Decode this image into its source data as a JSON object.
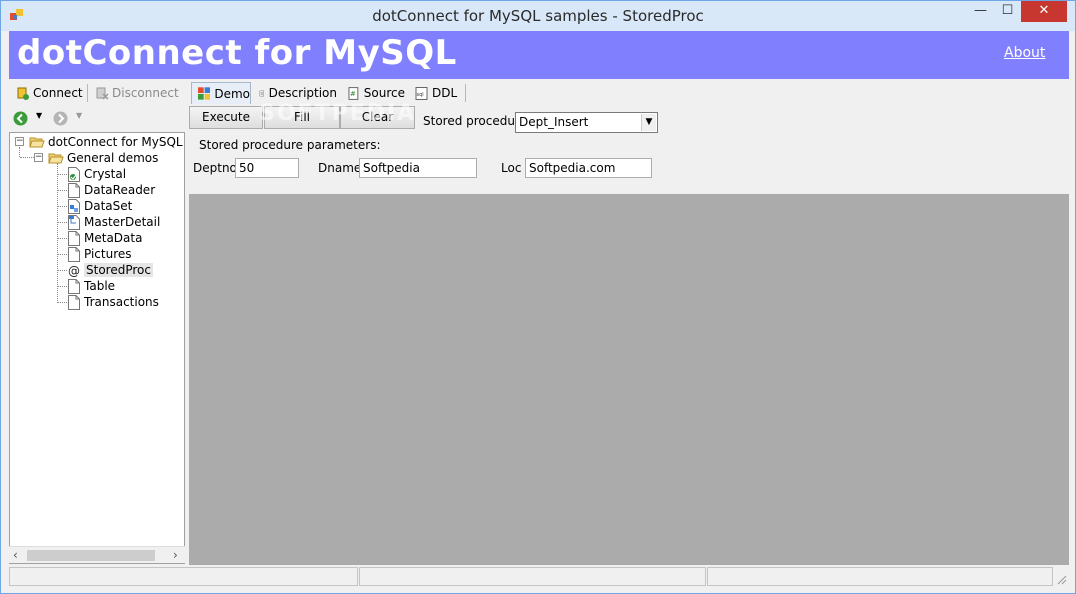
{
  "window": {
    "title": "dotConnect for MySQL samples - StoredProc",
    "controls": {
      "minimize": "—",
      "maximize": "☐",
      "close": "✕"
    }
  },
  "banner": {
    "title": "dotConnect for MySQL",
    "about_link": "About",
    "color": "#8080ff"
  },
  "left_toolbar": {
    "connect_label": "Connect",
    "disconnect_label": "Disconnect"
  },
  "tree": {
    "root": "dotConnect for MySQL samples",
    "group": "General demos",
    "items": [
      {
        "label": "Crystal",
        "icon": "crystal-icon"
      },
      {
        "label": "DataReader",
        "icon": "document-icon"
      },
      {
        "label": "DataSet",
        "icon": "dataset-icon"
      },
      {
        "label": "MasterDetail",
        "icon": "master-detail-icon"
      },
      {
        "label": "MetaData",
        "icon": "document-icon"
      },
      {
        "label": "Pictures",
        "icon": "document-icon"
      },
      {
        "label": "StoredProc",
        "icon": "at-icon",
        "selected": true
      },
      {
        "label": "Table",
        "icon": "document-icon"
      },
      {
        "label": "Transactions",
        "icon": "document-icon"
      }
    ]
  },
  "tabs": [
    {
      "label": "Demo",
      "icon": "demo-icon",
      "active": true
    },
    {
      "label": "Description",
      "icon": "description-icon"
    },
    {
      "label": "Source",
      "icon": "source-icon"
    },
    {
      "label": "DDL",
      "icon": "sql-icon"
    }
  ],
  "demo": {
    "execute_label": "Execute",
    "fill_label": "Fill",
    "clear_label": "Clear",
    "stored_procedure_label": "Stored procedure",
    "stored_procedure_value": "Dept_Insert",
    "params_label": "Stored procedure parameters:",
    "params": [
      {
        "label": "Deptno",
        "value": "50"
      },
      {
        "label": "Dname",
        "value": "Softpedia"
      },
      {
        "label": "Loc",
        "value": "Softpedia.com"
      }
    ]
  },
  "watermark": "SOFTPEDIA",
  "colors": {
    "title_bar": "#d9e8f8",
    "close_button": "#c7372f",
    "content_area": "#ababab"
  }
}
